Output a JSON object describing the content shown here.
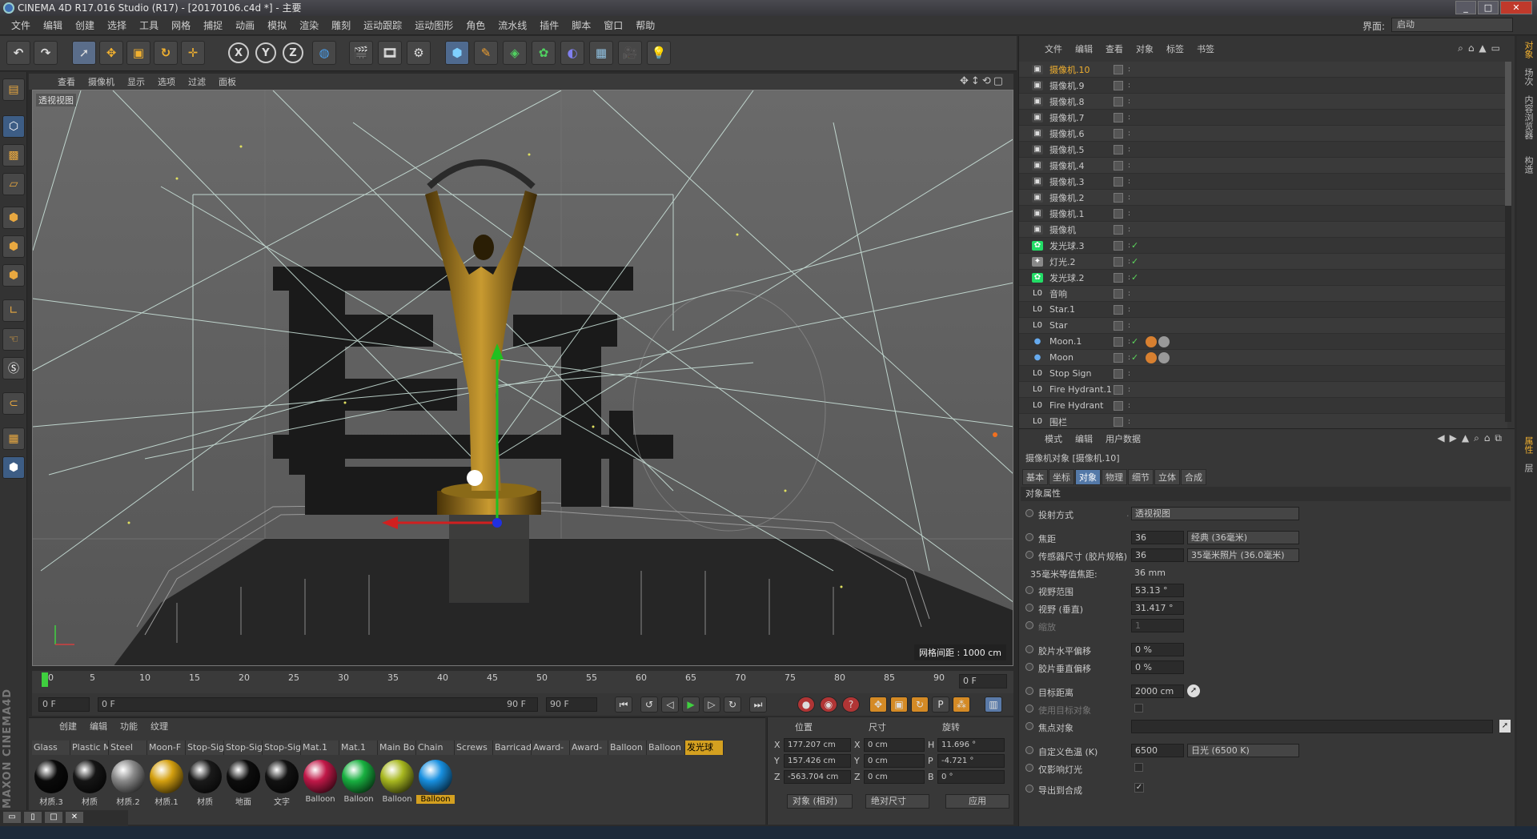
{
  "window": {
    "title": "CINEMA 4D R17.016 Studio (R17) - [20170106.c4d *] - 主要",
    "min": "_",
    "max": "□",
    "close": "✕"
  },
  "menu": [
    "文件",
    "编辑",
    "创建",
    "选择",
    "工具",
    "网格",
    "捕捉",
    "动画",
    "模拟",
    "渲染",
    "雕刻",
    "运动跟踪",
    "运动图形",
    "角色",
    "流水线",
    "插件",
    "脚本",
    "窗口",
    "帮助"
  ],
  "layout": {
    "label": "界面:",
    "value": "启动"
  },
  "toolbar": {
    "axis_x": "X",
    "axis_y": "Y",
    "axis_z": "Z"
  },
  "viewport": {
    "menu": [
      "查看",
      "摄像机",
      "显示",
      "选项",
      "过滤",
      "面板"
    ],
    "label": "透视视图",
    "grid_info": "网格间距 : 1000 cm"
  },
  "timeline": {
    "ticks": [
      "0",
      "5",
      "10",
      "15",
      "20",
      "25",
      "30",
      "35",
      "40",
      "45",
      "50",
      "55",
      "60",
      "65",
      "70",
      "75",
      "80",
      "85",
      "90"
    ],
    "current_frame": "0 F"
  },
  "transport": {
    "start": "0 F",
    "range_start": "0 F",
    "range_end": "90 F",
    "end": "90 F"
  },
  "material_manager": {
    "menu": [
      "创建",
      "编辑",
      "功能",
      "纹理"
    ],
    "tabs": [
      "Glass",
      "Plastic M",
      "Steel",
      "Moon-F",
      "Stop-Sig",
      "Stop-Sig",
      "Stop-Sig",
      "Mat.1",
      "Mat.1",
      "Main Bo",
      "Chain",
      "Screws",
      "Barricad",
      "Award-",
      "Award-",
      "Balloon",
      "Balloon",
      "发光球"
    ],
    "materials": [
      {
        "label": "材质.3",
        "color": "#0a0a0a"
      },
      {
        "label": "材质",
        "color": "#151515"
      },
      {
        "label": "材质.2",
        "color": "#8a8a8a"
      },
      {
        "label": "材质.1",
        "color": "#d4a010"
      },
      {
        "label": "材质",
        "color": "#1a1a1a"
      },
      {
        "label": "地面",
        "color": "#0d0d0d"
      },
      {
        "label": "文字",
        "color": "#121212"
      },
      {
        "label": "Balloon",
        "color": "#c01848"
      },
      {
        "label": "Balloon",
        "color": "#18b040"
      },
      {
        "label": "Balloon",
        "color": "#a8b820"
      },
      {
        "label": "Balloon",
        "color": "#1890e0"
      }
    ]
  },
  "coord_manager": {
    "headers": [
      "位置",
      "尺寸",
      "旋转"
    ],
    "rows": [
      {
        "axis": "X",
        "pos": "177.207 cm",
        "size_axis": "X",
        "size": "0 cm",
        "rot_axis": "H",
        "rot": "11.696 °"
      },
      {
        "axis": "Y",
        "pos": "157.426 cm",
        "size_axis": "Y",
        "size": "0 cm",
        "rot_axis": "P",
        "rot": "-4.721 °"
      },
      {
        "axis": "Z",
        "pos": "-563.704 cm",
        "size_axis": "Z",
        "size": "0 cm",
        "rot_axis": "B",
        "rot": "0 °"
      }
    ],
    "mode": "对象 (相对)",
    "size_mode": "绝对尺寸",
    "apply": "应用"
  },
  "object_manager": {
    "menu": [
      "文件",
      "编辑",
      "查看",
      "对象",
      "标签",
      "书签"
    ],
    "objects": [
      {
        "name": "摄像机.10",
        "type": "camera",
        "active": true
      },
      {
        "name": "摄像机.9",
        "type": "camera"
      },
      {
        "name": "摄像机.8",
        "type": "camera"
      },
      {
        "name": "摄像机.7",
        "type": "camera"
      },
      {
        "name": "摄像机.6",
        "type": "camera"
      },
      {
        "name": "摄像机.5",
        "type": "camera"
      },
      {
        "name": "摄像机.4",
        "type": "camera"
      },
      {
        "name": "摄像机.3",
        "type": "camera"
      },
      {
        "name": "摄像机.2",
        "type": "camera"
      },
      {
        "name": "摄像机.1",
        "type": "camera"
      },
      {
        "name": "摄像机",
        "type": "camera"
      },
      {
        "name": "发光球.3",
        "type": "glow",
        "check": true
      },
      {
        "name": "灯光.2",
        "type": "light",
        "check": true
      },
      {
        "name": "发光球.2",
        "type": "glow",
        "check": true
      },
      {
        "name": "音响",
        "type": "null"
      },
      {
        "name": "Star.1",
        "type": "null"
      },
      {
        "name": "Star",
        "type": "null"
      },
      {
        "name": "Moon.1",
        "type": "sphere",
        "check": true
      },
      {
        "name": "Moon",
        "type": "sphere",
        "check": true
      },
      {
        "name": "Stop Sign",
        "type": "null"
      },
      {
        "name": "Fire Hydrant.1",
        "type": "null"
      },
      {
        "name": "Fire Hydrant",
        "type": "null"
      },
      {
        "name": "围栏",
        "type": "null"
      }
    ]
  },
  "attribute_manager": {
    "menu": [
      "模式",
      "编辑",
      "用户数据"
    ],
    "title": "摄像机对象 [摄像机.10]",
    "tabs": [
      "基本",
      "坐标",
      "对象",
      "物理",
      "细节",
      "立体",
      "合成"
    ],
    "active_tab": "对象",
    "section": "对象属性",
    "rows": [
      {
        "label": "投射方式",
        "value": "透视视图"
      },
      {
        "label": "焦距",
        "value": "36",
        "extra": "经典 (36毫米)"
      },
      {
        "label": "传感器尺寸 (胶片规格)",
        "value": "36",
        "extra": "35毫米照片 (36.0毫米)"
      },
      {
        "label": "35毫米等值焦距:",
        "value": "36 mm"
      },
      {
        "label": "视野范围",
        "value": "53.13 °"
      },
      {
        "label": "视野 (垂直)",
        "value": "31.417 °"
      },
      {
        "label": "缩放",
        "value": "1"
      },
      {
        "label": "胶片水平偏移",
        "value": "0 %"
      },
      {
        "label": "胶片垂直偏移",
        "value": "0 %"
      },
      {
        "label": "目标距离",
        "value": "2000 cm"
      },
      {
        "label": "使用目标对象",
        "value": ""
      },
      {
        "label": "焦点对象",
        "value": ""
      },
      {
        "label": "自定义色温 (K)",
        "value": "6500",
        "extra": "日光 (6500 K)"
      },
      {
        "label": "仅影响灯光",
        "value": ""
      },
      {
        "label": "导出到合成",
        "value": "✓"
      }
    ]
  },
  "right_tabs": [
    "对象",
    "场次",
    "内容浏览器",
    "构造",
    "属性",
    "层"
  ]
}
